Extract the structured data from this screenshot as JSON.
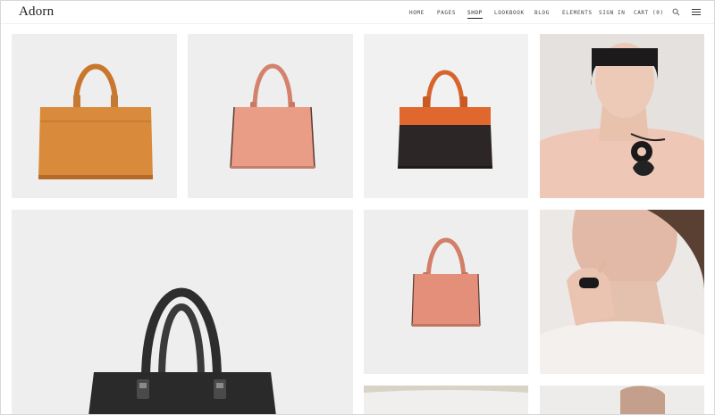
{
  "brand": {
    "name": "Adorn"
  },
  "nav": {
    "home": "HOME",
    "pages": "PAGES",
    "shop": "SHOP",
    "lookbook": "LOOKBOOK",
    "blog": "BLOG",
    "elements": "ELEMENTS",
    "sign_in": "SIGN IN",
    "cart": "CART (0)"
  },
  "icons": {
    "search": "search-icon",
    "menu": "hamburger-menu-icon"
  },
  "colors": {
    "tan_bag": "#d98a3a",
    "pink_bag": "#e99d86",
    "orange_top": "#e0672d",
    "dark_bag": "#2c2726",
    "black_bag": "#2a2a2a",
    "tile_bg": "#eeeeee"
  },
  "products": [
    {
      "id": "tan-handbag",
      "image": "tan leather handbag"
    },
    {
      "id": "pink-handbag",
      "image": "pink leather handbag"
    },
    {
      "id": "orange-black-handbag",
      "image": "orange and black handbag"
    },
    {
      "id": "model-necklace",
      "image": "model wearing black pendant necklace"
    },
    {
      "id": "black-handbag-large",
      "image": "black leather handbag"
    },
    {
      "id": "pink-tote",
      "image": "pink tote bag"
    },
    {
      "id": "model-ring",
      "image": "model wearing black ring"
    },
    {
      "id": "bottom-tile-1",
      "image": "product"
    },
    {
      "id": "bottom-tile-2",
      "image": "model"
    }
  ]
}
